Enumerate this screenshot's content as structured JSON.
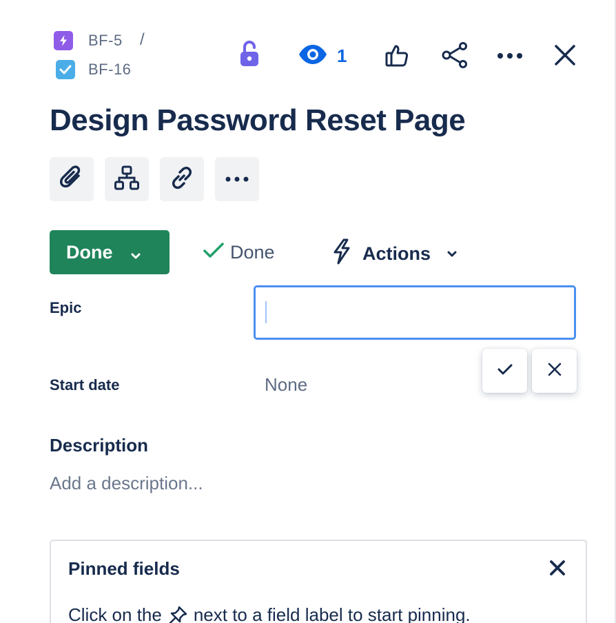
{
  "breadcrumb": {
    "parent": {
      "key": "BF-5",
      "icon": "epic-lightning-icon",
      "color": "#8f5ce8"
    },
    "separator": "/",
    "current": {
      "key": "BF-16",
      "icon": "task-check-icon",
      "color": "#4bade8"
    }
  },
  "header": {
    "icons": [
      "unlock-icon",
      "eye-icon",
      "thumbs-up-icon",
      "share-icon",
      "more-icon",
      "close-icon"
    ],
    "watch_count": "1",
    "accent": "#0c66e4"
  },
  "issue": {
    "title": "Design Password Reset Page"
  },
  "toolbar": {
    "icons": [
      "attachment-icon",
      "child-issues-icon",
      "link-icon",
      "more-icon"
    ]
  },
  "status": {
    "button_label": "Done",
    "button_color": "#1f845a",
    "resolution_label": "Done",
    "actions_label": "Actions"
  },
  "fields": {
    "epic": {
      "label": "Epic",
      "value": "",
      "placeholder": ""
    },
    "start_date": {
      "label": "Start date",
      "value": "None"
    }
  },
  "description": {
    "heading": "Description",
    "placeholder": "Add a description..."
  },
  "pinned": {
    "title": "Pinned fields",
    "hint_before": "Click on the",
    "hint_after": "next to a field label to start pinning."
  }
}
